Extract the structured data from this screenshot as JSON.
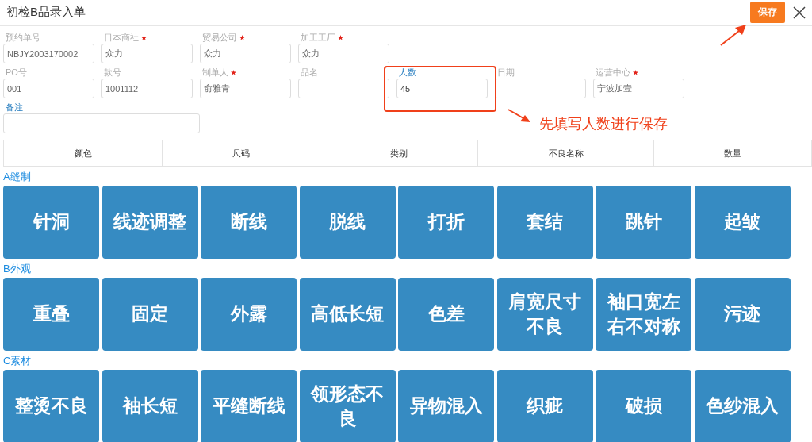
{
  "window": {
    "title": "初检B品录入单"
  },
  "save_button": "保存",
  "fields": [
    {
      "label": "预约单号",
      "required": false,
      "editable": false,
      "value": "NBJY2003170002"
    },
    {
      "label": "日本商社",
      "required": true,
      "editable": false,
      "value": "众力"
    },
    {
      "label": "贸易公司",
      "required": true,
      "editable": false,
      "value": "众力"
    },
    {
      "label": "加工工厂",
      "required": true,
      "editable": false,
      "value": "众力"
    },
    {
      "label": "PO号",
      "required": false,
      "editable": false,
      "value": "001"
    },
    {
      "label": "款号",
      "required": false,
      "editable": false,
      "value": "1001112"
    },
    {
      "label": "制单人",
      "required": true,
      "editable": false,
      "value": "俞雅青"
    },
    {
      "label": "品名",
      "required": false,
      "editable": false
    },
    {
      "label": "人数",
      "required": false,
      "editable": true,
      "value": "45"
    },
    {
      "label": "日期",
      "required": false,
      "editable": false
    },
    {
      "label": "运营中心",
      "required": true,
      "editable": false,
      "value": "宁波加壹"
    }
  ],
  "remark": {
    "label": "备注",
    "editable": true
  },
  "table": {
    "columns": [
      "颜色",
      "尺码",
      "类别",
      "不良名称",
      "数量"
    ]
  },
  "sections": [
    {
      "title": "A缝制",
      "buttons": [
        "针洞",
        "线迹调整",
        "断线",
        "脱线",
        "打折",
        "套结",
        "跳针",
        "起皱"
      ]
    },
    {
      "title": "B外观",
      "buttons": [
        "重叠",
        "固定",
        "外露",
        "高低长短",
        "色差",
        "肩宽尺寸不良",
        "袖口宽左右不对称",
        "污迹"
      ]
    },
    {
      "title": "C素材",
      "buttons": [
        "整烫不良",
        "袖长短",
        "平缝断线",
        "领形态不良",
        "异物混入",
        "织疵",
        "破损",
        "色纱混入"
      ]
    }
  ],
  "annotation": {
    "text": "先填写人数进行保存"
  }
}
